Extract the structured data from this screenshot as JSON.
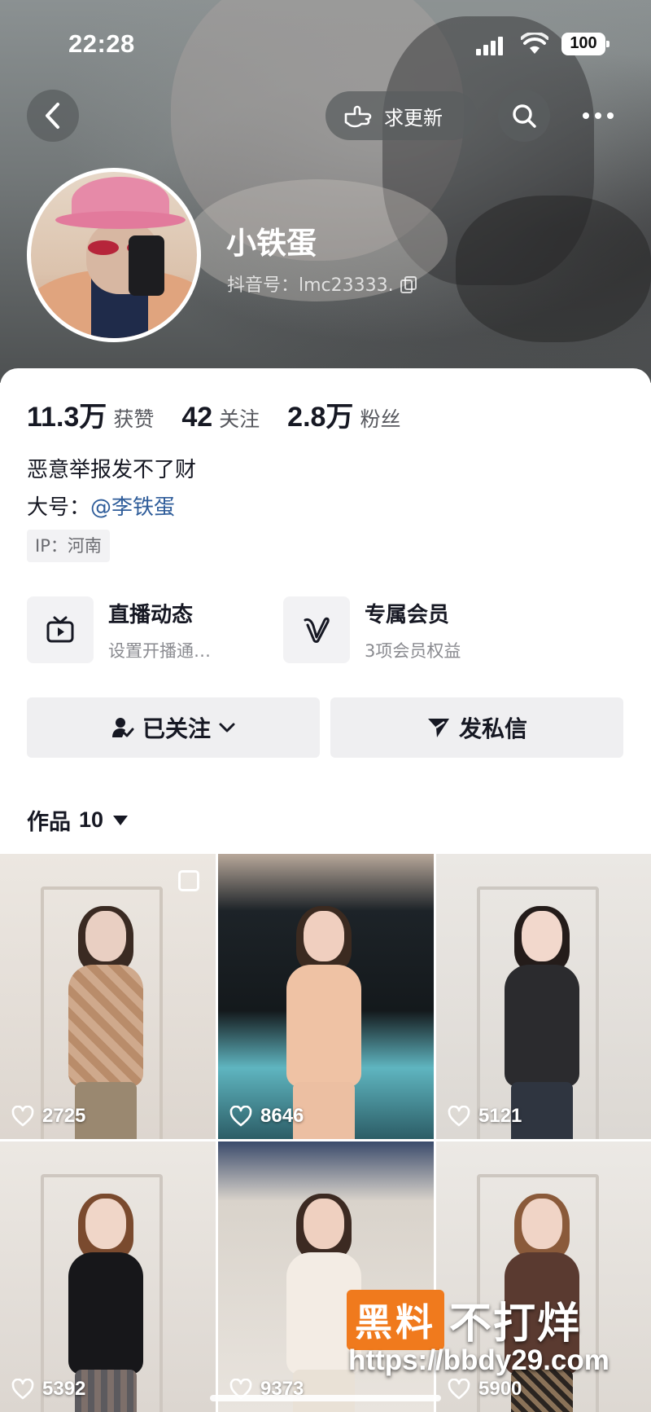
{
  "status_bar": {
    "time": "22:28",
    "battery": "100"
  },
  "header": {
    "request_update_label": "求更新",
    "icons": {
      "back": "chevron-left-icon",
      "search": "search-icon",
      "more": "more-dots-icon",
      "request": "pointing-hand-icon"
    }
  },
  "profile": {
    "name": "小铁蛋",
    "douyin_id": "抖音号：lmc23333.",
    "stats": [
      {
        "value": "11.3万",
        "label": "获赞"
      },
      {
        "value": "42",
        "label": "关注"
      },
      {
        "value": "2.8万",
        "label": "粉丝"
      }
    ],
    "bio": "恶意举报发不了财",
    "alt_account_prefix": "大号：",
    "alt_account_link": "@李铁蛋",
    "ip": "IP：河南"
  },
  "features": [
    {
      "title": "直播动态",
      "subtitle": "设置开播通…",
      "icon": "tv-icon"
    },
    {
      "title": "专属会员",
      "subtitle": "3项会员权益",
      "icon": "v-badge-icon"
    }
  ],
  "actions": {
    "follow_label": "已关注",
    "message_label": "发私信"
  },
  "works": {
    "label": "作品",
    "count": "10",
    "items": [
      {
        "likes": "2725"
      },
      {
        "likes": "8646"
      },
      {
        "likes": "5121"
      },
      {
        "likes": "5392"
      },
      {
        "likes": "9373"
      },
      {
        "likes": "5900"
      }
    ]
  },
  "watermark": {
    "box_text": "黑料",
    "rest_text": "不打烊",
    "url": "https://bbdy29.com"
  }
}
